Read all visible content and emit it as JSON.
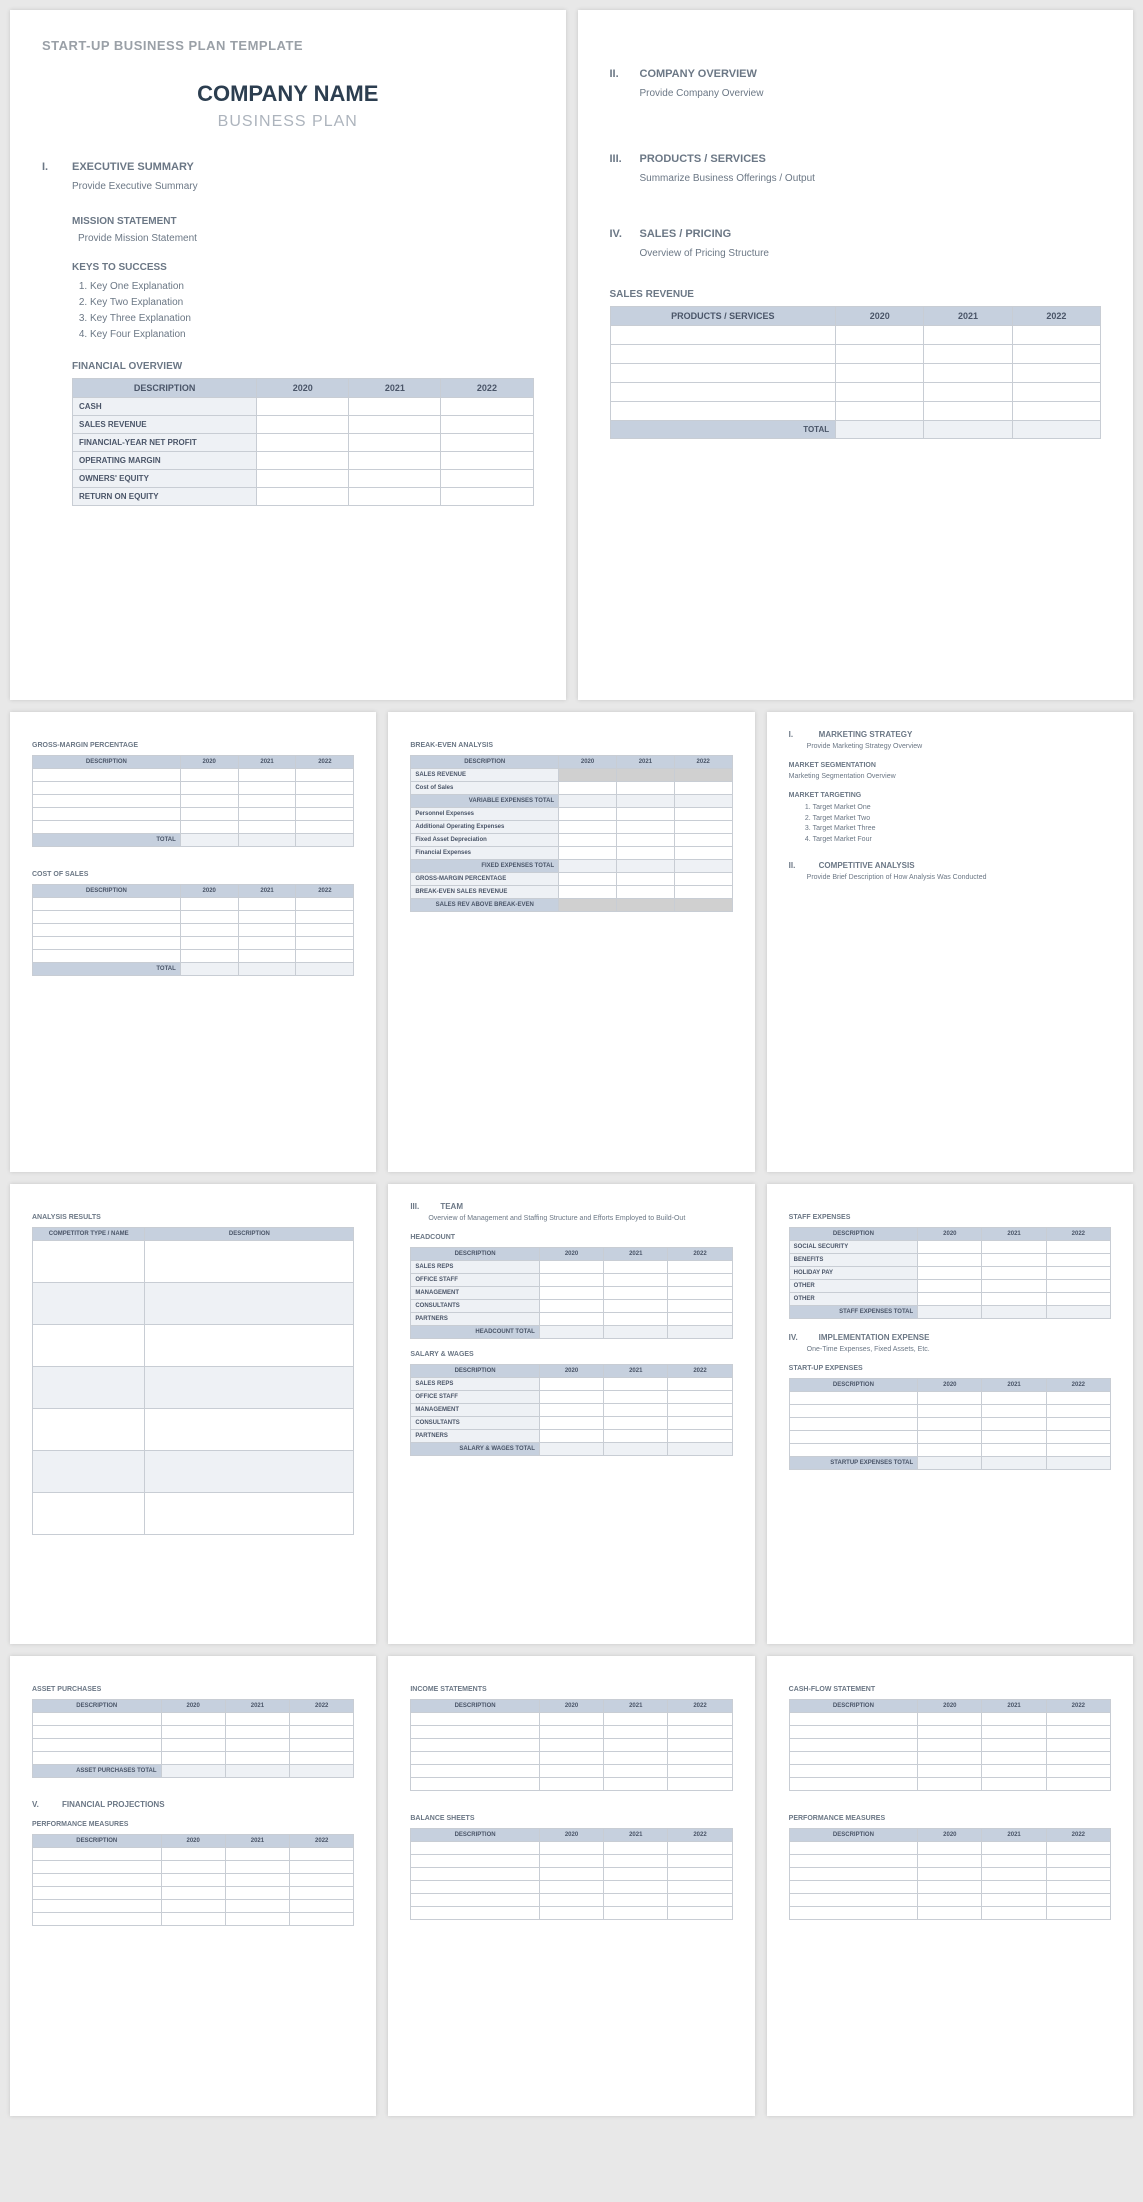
{
  "template_title": "START-UP BUSINESS PLAN TEMPLATE",
  "company_name": "COMPANY NAME",
  "business_plan": "BUSINESS PLAN",
  "years": [
    "2020",
    "2021",
    "2022"
  ],
  "p1": {
    "s1": {
      "num": "I.",
      "title": "EXECUTIVE SUMMARY",
      "body": "Provide Executive Summary"
    },
    "mission": {
      "h": "MISSION STATEMENT",
      "body": "Provide Mission Statement"
    },
    "keys": {
      "h": "KEYS TO SUCCESS",
      "items": [
        "Key One Explanation",
        "Key Two Explanation",
        "Key Three Explanation",
        "Key Four Explanation"
      ]
    },
    "fin": {
      "h": "FINANCIAL OVERVIEW",
      "desc": "DESCRIPTION",
      "rows": [
        "CASH",
        "SALES REVENUE",
        "FINANCIAL-YEAR NET PROFIT",
        "OPERATING MARGIN",
        "OWNERS' EQUITY",
        "RETURN ON EQUITY"
      ]
    }
  },
  "p2": {
    "s2": {
      "num": "II.",
      "title": "COMPANY OVERVIEW",
      "body": "Provide Company Overview"
    },
    "s3": {
      "num": "III.",
      "title": "PRODUCTS / SERVICES",
      "body": "Summarize Business Offerings / Output"
    },
    "s4": {
      "num": "IV.",
      "title": "SALES / PRICING",
      "body": "Overview of Pricing Structure"
    },
    "rev": {
      "h": "SALES REVENUE",
      "col": "PRODUCTS / SERVICES",
      "total": "TOTAL"
    }
  },
  "p3": {
    "gm": {
      "h": "GROSS-MARGIN PERCENTAGE",
      "desc": "DESCRIPTION",
      "total": "TOTAL"
    },
    "cos": {
      "h": "COST OF SALES",
      "desc": "DESCRIPTION",
      "total": "TOTAL"
    }
  },
  "p4": {
    "h": "BREAK-EVEN ANALYSIS",
    "desc": "DESCRIPTION",
    "rows": {
      "sr": "SALES REVENUE",
      "cos": "Cost of Sales",
      "vet": "VARIABLE EXPENSES TOTAL",
      "pe": "Personnel Expenses",
      "aoe": "Additional Operating Expenses",
      "fad": "Fixed Asset Depreciation",
      "fe": "Financial Expenses",
      "fet": "FIXED EXPENSES TOTAL",
      "gmp": "GROSS-MARGIN PERCENTAGE",
      "besr": "BREAK-EVEN SALES REVENUE",
      "srabe": "SALES REV ABOVE BREAK-EVEN"
    }
  },
  "p5": {
    "s1": {
      "num": "I.",
      "title": "MARKETING STRATEGY",
      "body": "Provide Marketing Strategy Overview"
    },
    "ms": {
      "h": "MARKET SEGMENTATION",
      "body": "Marketing Segmentation Overview"
    },
    "mt": {
      "h": "MARKET TARGETING",
      "items": [
        "Target Market One",
        "Target Market Two",
        "Target Market Three",
        "Target Market Four"
      ]
    },
    "s2": {
      "num": "II.",
      "title": "COMPETITIVE ANALYSIS",
      "body": "Provide Brief Description of How Analysis Was Conducted"
    }
  },
  "p6": {
    "h": "ANALYSIS RESULTS",
    "c1": "COMPETITOR TYPE / NAME",
    "c2": "DESCRIPTION"
  },
  "p7": {
    "s3": {
      "num": "III.",
      "title": "TEAM",
      "body": "Overview of Management and Staffing Structure and Efforts Employed to Build-Out"
    },
    "hc": {
      "h": "HEADCOUNT",
      "desc": "DESCRIPTION",
      "rows": [
        "SALES REPS",
        "OFFICE STAFF",
        "MANAGEMENT",
        "CONSULTANTS",
        "PARTNERS"
      ],
      "total": "HEADCOUNT TOTAL"
    },
    "sw": {
      "h": "SALARY & WAGES",
      "desc": "DESCRIPTION",
      "rows": [
        "SALES REPS",
        "OFFICE STAFF",
        "MANAGEMENT",
        "CONSULTANTS",
        "PARTNERS"
      ],
      "total": "SALARY & WAGES TOTAL"
    }
  },
  "p8": {
    "se": {
      "h": "STAFF EXPENSES",
      "desc": "DESCRIPTION",
      "rows": [
        "SOCIAL SECURITY",
        "BENEFITS",
        "HOLIDAY PAY",
        "OTHER",
        "OTHER"
      ],
      "total": "STAFF EXPENSES TOTAL"
    },
    "s4": {
      "num": "IV.",
      "title": "IMPLEMENTATION EXPENSE",
      "body": "One-Time Expenses, Fixed Assets, Etc."
    },
    "sue": {
      "h": "START-UP EXPENSES",
      "desc": "DESCRIPTION",
      "total": "STARTUP EXPENSES TOTAL"
    }
  },
  "p9": {
    "ap": {
      "h": "ASSET PURCHASES",
      "desc": "DESCRIPTION",
      "total": "ASSET PURCHASES TOTAL"
    },
    "s5": {
      "num": "V.",
      "title": "FINANCIAL PROJECTIONS"
    },
    "pm": {
      "h": "PERFORMANCE MEASURES",
      "desc": "DESCRIPTION"
    }
  },
  "p10": {
    "is": {
      "h": "INCOME STATEMENTS",
      "desc": "DESCRIPTION"
    },
    "bs": {
      "h": "BALANCE SHEETS",
      "desc": "DESCRIPTION"
    }
  },
  "p11": {
    "cf": {
      "h": "CASH-FLOW STATEMENT",
      "desc": "DESCRIPTION"
    },
    "pm": {
      "h": "PERFORMANCE MEASURES",
      "desc": "DESCRIPTION"
    }
  }
}
